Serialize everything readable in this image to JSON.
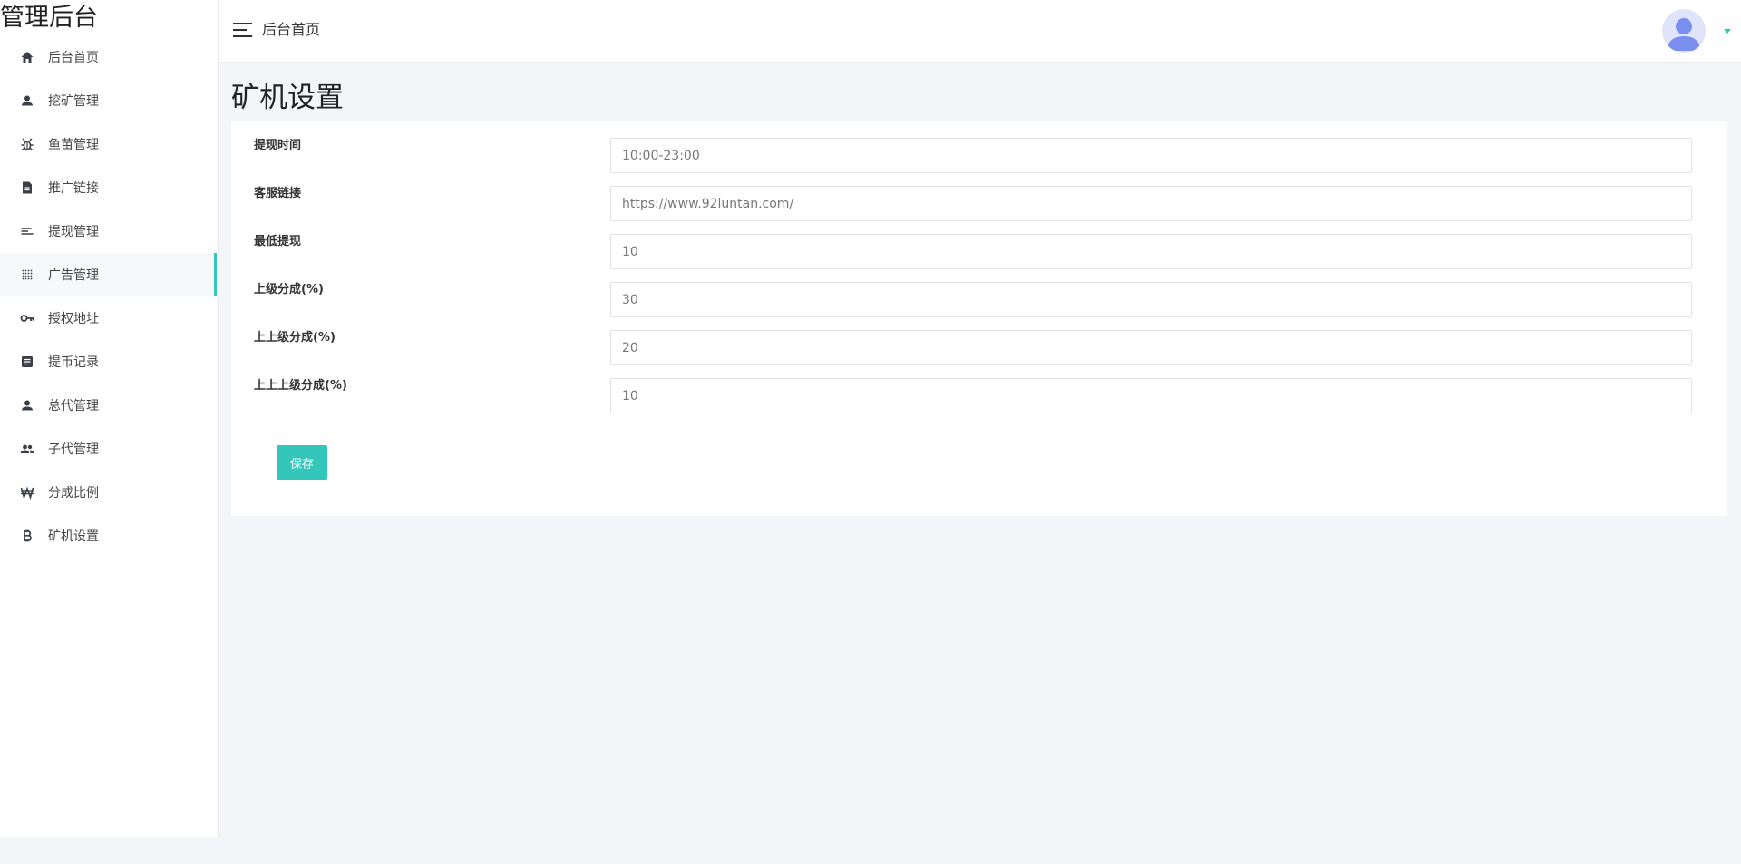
{
  "sidebar": {
    "brand": "管理后台",
    "items": [
      {
        "label": "后台首页",
        "icon": "home-icon"
      },
      {
        "label": "挖矿管理",
        "icon": "person-icon"
      },
      {
        "label": "鱼苗管理",
        "icon": "bug-icon"
      },
      {
        "label": "推广链接",
        "icon": "document-icon"
      },
      {
        "label": "提现管理",
        "icon": "list-icon"
      },
      {
        "label": "广告管理",
        "icon": "grid-dots-icon",
        "active": true
      },
      {
        "label": "授权地址",
        "icon": "key-icon"
      },
      {
        "label": "提币记录",
        "icon": "notes-icon"
      },
      {
        "label": "总代管理",
        "icon": "person-icon"
      },
      {
        "label": "子代管理",
        "icon": "people-icon"
      },
      {
        "label": "分成比例",
        "icon": "won-icon"
      },
      {
        "label": "矿机设置",
        "icon": "bitcoin-icon"
      }
    ]
  },
  "header": {
    "title": "后台首页"
  },
  "main": {
    "page_title": "矿机设置",
    "form": {
      "fields": [
        {
          "label": "提现时间",
          "value": "10:00-23:00"
        },
        {
          "label": "客服链接",
          "value": "https://www.92luntan.com/"
        },
        {
          "label": "最低提现",
          "value": "10"
        },
        {
          "label": "上级分成(%)",
          "value": "30"
        },
        {
          "label": "上上级分成(%)",
          "value": "20"
        },
        {
          "label": "上上上级分成(%)",
          "value": "10"
        }
      ],
      "save_label": "保存"
    }
  },
  "colors": {
    "accent": "#34c6ba",
    "background": "#f4f5f9",
    "avatar_bg": "#dfe4fa",
    "avatar_fg": "#7b8ff0"
  }
}
